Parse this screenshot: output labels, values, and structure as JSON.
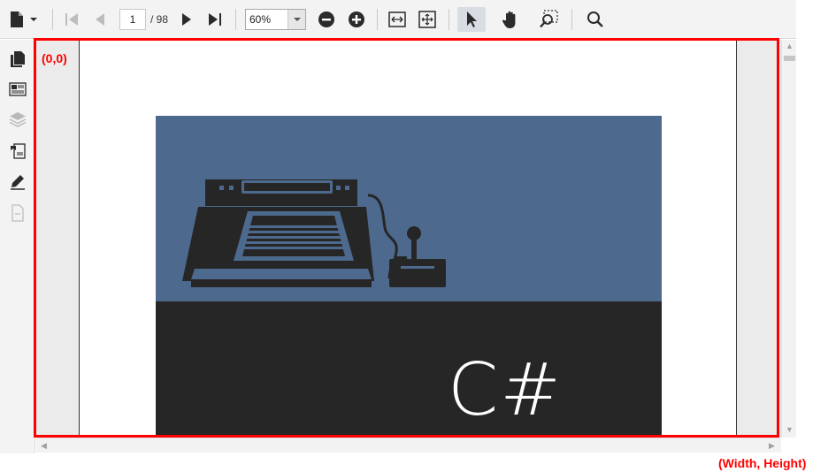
{
  "toolbar": {
    "file_icon": "document-icon",
    "dropdown_icon": "chevron-down-icon",
    "first_page_icon": "first-page-icon",
    "prev_page_icon": "previous-page-icon",
    "page_number": "1",
    "page_total": "/ 98",
    "next_page_icon": "next-page-icon",
    "last_page_icon": "last-page-icon",
    "zoom_value": "60%",
    "zoom_out_icon": "zoom-out-icon",
    "zoom_in_icon": "zoom-in-icon",
    "fit_width_icon": "fit-width-icon",
    "fit_page_icon": "fit-page-icon",
    "select_tool_icon": "select-cursor-icon",
    "pan_tool_icon": "hand-icon",
    "marquee_zoom_icon": "marquee-zoom-icon",
    "search_icon": "search-icon"
  },
  "sidebar": {
    "items": [
      {
        "icon": "pages-icon",
        "enabled": true
      },
      {
        "icon": "thumbnails-icon",
        "enabled": true
      },
      {
        "icon": "layers-icon",
        "enabled": false
      },
      {
        "icon": "bookmarks-icon",
        "enabled": true
      },
      {
        "icon": "signature-icon",
        "enabled": true
      },
      {
        "icon": "attachment-icon",
        "enabled": false
      }
    ]
  },
  "document": {
    "cover_title": "C#"
  },
  "annotations": {
    "origin_label": "(0,0)",
    "size_label": "(Width, Height)"
  },
  "colors": {
    "accent_red": "#ff0000",
    "cover_blue": "#4d6a8e",
    "cover_dark": "#262626",
    "icon_dark": "#2b2b2b"
  }
}
